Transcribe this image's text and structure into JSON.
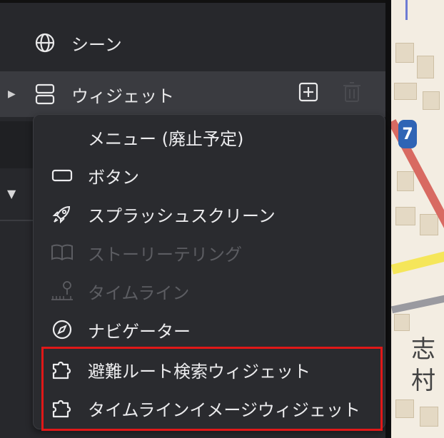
{
  "sidebar": {
    "scene_label": "シーン",
    "widget_label": "ウィジェット"
  },
  "menu": {
    "items": [
      {
        "label": "メニュー (廃止予定)",
        "icon": "none",
        "disabled": false
      },
      {
        "label": "ボタン",
        "icon": "button-icon",
        "disabled": false
      },
      {
        "label": "スプラッシュスクリーン",
        "icon": "rocket-icon",
        "disabled": false
      },
      {
        "label": "ストーリーテリング",
        "icon": "book-icon",
        "disabled": true
      },
      {
        "label": "タイムライン",
        "icon": "timeline-icon",
        "disabled": true
      },
      {
        "label": "ナビゲーター",
        "icon": "compass-icon",
        "disabled": false
      },
      {
        "label": "避難ルート検索ウィジェット",
        "icon": "puzzle-icon",
        "disabled": false
      },
      {
        "label": "タイムラインイメージウィジェット",
        "icon": "puzzle-icon",
        "disabled": false
      }
    ]
  },
  "map": {
    "route_badge": "7",
    "place_label_1": "志",
    "place_label_2": "村"
  },
  "colors": {
    "panel_bg": "#27282c",
    "menu_bg": "#2a2b2f",
    "highlight": "#e01818",
    "disabled_text": "#5c5d62"
  }
}
